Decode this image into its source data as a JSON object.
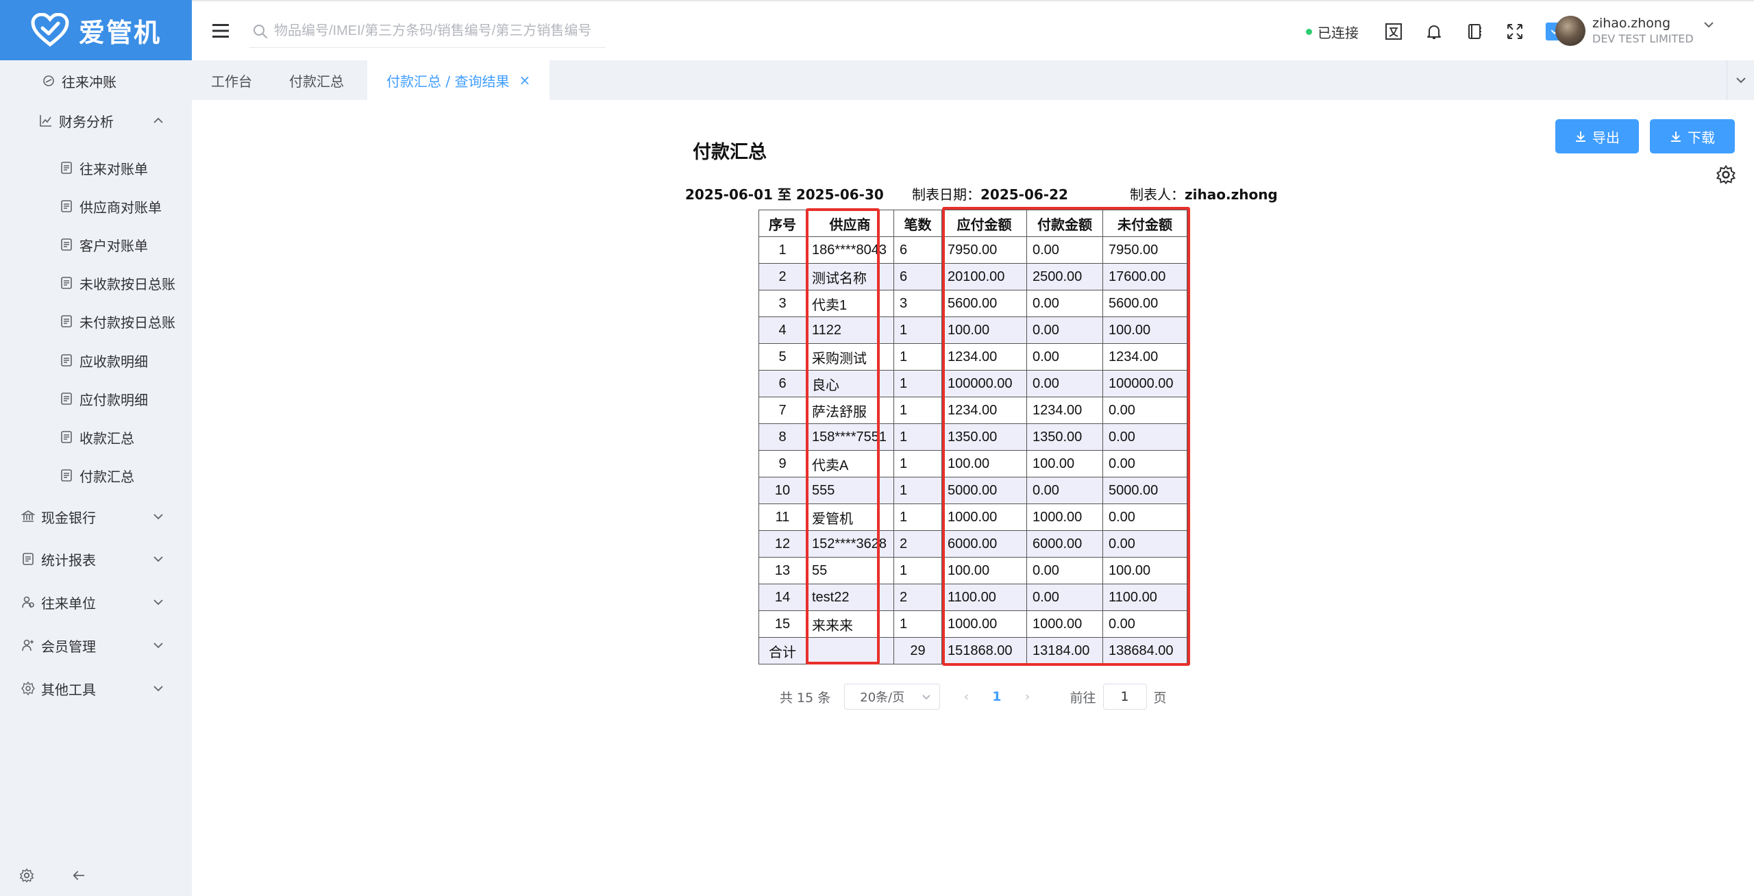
{
  "app": {
    "logo_text": "爱管机"
  },
  "sidebar": {
    "items": [
      {
        "label": "往来冲账",
        "icon": "link-icon",
        "level": 2
      },
      {
        "label": "财务分析",
        "icon": "chart-icon",
        "level": 1,
        "expanded": true
      },
      {
        "label": "往来对账单",
        "icon": "yen-doc-icon",
        "level": 2
      },
      {
        "label": "供应商对账单",
        "icon": "doc-icon",
        "level": 2
      },
      {
        "label": "客户对账单",
        "icon": "user-search-icon",
        "level": 2
      },
      {
        "label": "未收款按日总账",
        "icon": "yen-doc-icon",
        "level": 2
      },
      {
        "label": "未付款按日总账",
        "icon": "wallet-icon",
        "level": 2
      },
      {
        "label": "应收款明细",
        "icon": "receipt-icon",
        "level": 2
      },
      {
        "label": "应付款明细",
        "icon": "card-icon",
        "level": 2
      },
      {
        "label": "收款汇总",
        "icon": "badge-icon",
        "level": 2
      },
      {
        "label": "付款汇总",
        "icon": "home-yen-icon",
        "level": 2
      },
      {
        "label": "现金银行",
        "icon": "bank-icon",
        "level": 0
      },
      {
        "label": "统计报表",
        "icon": "clipboard-icon",
        "level": 0
      },
      {
        "label": "往来单位",
        "icon": "users-icon",
        "level": 0
      },
      {
        "label": "会员管理",
        "icon": "member-icon",
        "level": 0
      },
      {
        "label": "其他工具",
        "icon": "tools-icon",
        "level": 0
      }
    ]
  },
  "header": {
    "search_placeholder": "物品编号/IMEI/第三方条码/销售编号/第三方销售编号",
    "connection_status": "已连接",
    "user_name": "zihao.zhong",
    "company": "DEV TEST LIMITED"
  },
  "tabs": [
    {
      "label": "工作台"
    },
    {
      "label": "付款汇总"
    },
    {
      "label": "付款汇总 / 查询结果",
      "active": true
    }
  ],
  "actions": {
    "export_label": "导出",
    "download_label": "下载"
  },
  "report": {
    "title": "付款汇总",
    "date_range": "2025-06-01 至 2025-06-30",
    "made_date_label": "制表日期：",
    "made_date": "2025-06-22",
    "maker_label": "制表人：",
    "maker": "zihao.zhong",
    "columns": [
      "序号",
      "供应商",
      "笔数",
      "应付金额",
      "付款金额",
      "未付金额"
    ],
    "rows": [
      [
        "1",
        "186****8043",
        "6",
        "7950.00",
        "0.00",
        "7950.00"
      ],
      [
        "2",
        "测试名称",
        "6",
        "20100.00",
        "2500.00",
        "17600.00"
      ],
      [
        "3",
        "代卖1",
        "3",
        "5600.00",
        "0.00",
        "5600.00"
      ],
      [
        "4",
        "1122",
        "1",
        "100.00",
        "0.00",
        "100.00"
      ],
      [
        "5",
        "采购测试",
        "1",
        "1234.00",
        "0.00",
        "1234.00"
      ],
      [
        "6",
        "良心",
        "1",
        "100000.00",
        "0.00",
        "100000.00"
      ],
      [
        "7",
        "萨法舒服",
        "1",
        "1234.00",
        "1234.00",
        "0.00"
      ],
      [
        "8",
        "158****7551",
        "1",
        "1350.00",
        "1350.00",
        "0.00"
      ],
      [
        "9",
        "代卖A",
        "1",
        "100.00",
        "100.00",
        "0.00"
      ],
      [
        "10",
        "555",
        "1",
        "5000.00",
        "0.00",
        "5000.00"
      ],
      [
        "11",
        "爱管机",
        "1",
        "1000.00",
        "1000.00",
        "0.00"
      ],
      [
        "12",
        "152****3628",
        "2",
        "6000.00",
        "6000.00",
        "0.00"
      ],
      [
        "13",
        "55",
        "1",
        "100.00",
        "0.00",
        "100.00"
      ],
      [
        "14",
        "test22",
        "2",
        "1100.00",
        "0.00",
        "1100.00"
      ],
      [
        "15",
        "来来来",
        "1",
        "1000.00",
        "1000.00",
        "0.00"
      ]
    ],
    "total": [
      "合计",
      "",
      "29",
      "151868.00",
      "13184.00",
      "138684.00"
    ]
  },
  "pagination": {
    "total_text": "共 15 条",
    "page_size": "20条/页",
    "current_page": "1",
    "goto_label": "前往",
    "goto_value": "1",
    "page_suffix": "页"
  }
}
